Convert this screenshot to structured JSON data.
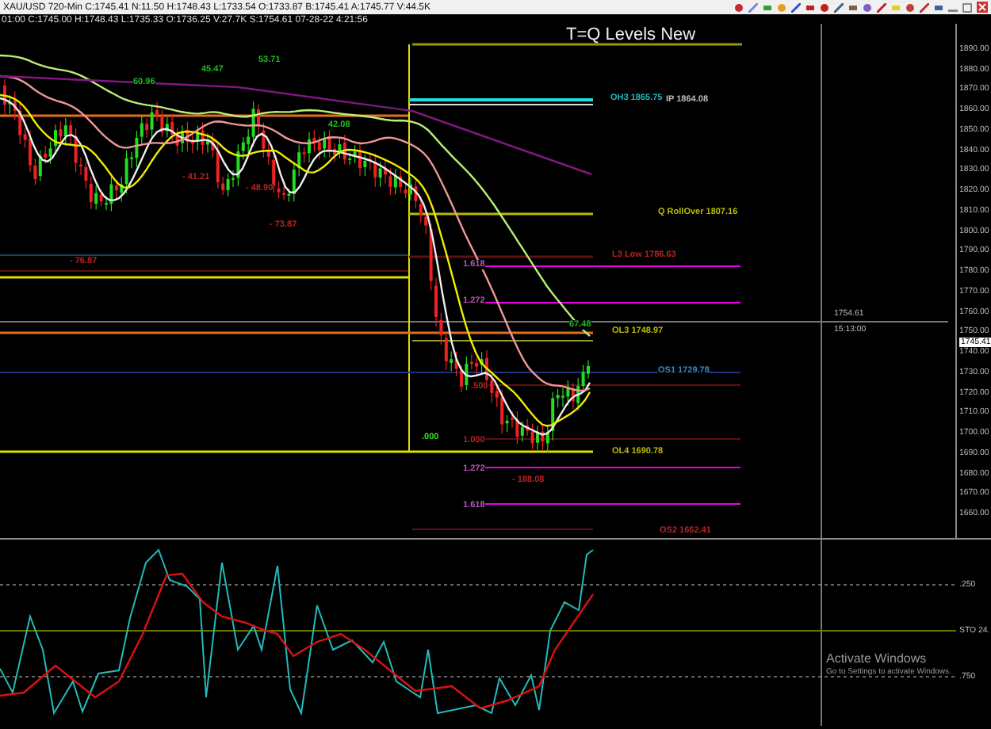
{
  "header": {
    "quote_line": "XAU/USD 720-Min C:1745.41 N:11.50 H:1748.43 L:1733.54 O:1733.87 B:1745.41 A:1745.77 V:44.5K"
  },
  "info_line": "01:00 C:1745.00 H:1748.43 L:1735.33 O:1736.25 V:27.7K S:1754.61 07-28-22 4:21:56",
  "chart": {
    "title": "T=Q Levels New",
    "price_axis": [
      "1890.00",
      "1880.00",
      "1870.00",
      "1860.00",
      "1850.00",
      "1840.00",
      "1830.00",
      "1820.00",
      "1810.00",
      "1800.00",
      "1790.00",
      "1780.00",
      "1770.00",
      "1760.00",
      "1750.00",
      "1740.00",
      "1730.00",
      "1720.00",
      "1710.00",
      "1700.00",
      "1690.00",
      "1680.00",
      "1670.00",
      "1660.00"
    ],
    "current_price": "1745.41",
    "crosshair": {
      "price": "1754.61",
      "time": "15:13:00"
    },
    "annotations": [
      {
        "text": "45.47",
        "color": "#22bb22"
      },
      {
        "text": "53.71",
        "color": "#22bb22"
      },
      {
        "text": "60.96",
        "color": "#22bb22"
      },
      {
        "text": "42.08",
        "color": "#22bb22"
      },
      {
        "text": "- 41.21",
        "color": "#bb2222"
      },
      {
        "text": "- 48.90",
        "color": "#bb2222"
      },
      {
        "text": "- 73.87",
        "color": "#bb2222"
      },
      {
        "text": "- 76.87",
        "color": "#bb2222"
      },
      {
        "text": "OH3 1865.75",
        "color": "#22bbbb"
      },
      {
        "text": "IP 1864.08",
        "color": "#bbbbbb"
      },
      {
        "text": "Q RollOver 1807.16",
        "color": "#bbbb00"
      },
      {
        "text": "L3 Low 1786.63",
        "color": "#bb2222"
      },
      {
        "text": "1.618",
        "color": "#bb55bb"
      },
      {
        "text": "1.272",
        "color": "#bb55bb"
      },
      {
        "text": "67.48",
        "color": "#22bb22"
      },
      {
        "text": "OL3 1748.97",
        "color": "#bbbb00"
      },
      {
        "text": "OS1 1729.78",
        "color": "#3388cc"
      },
      {
        "text": ".500",
        "color": "#bb2222"
      },
      {
        "text": ".000",
        "color": "#33dd33"
      },
      {
        "text": "1.000",
        "color": "#bb2222"
      },
      {
        "text": "OL4 1690.78",
        "color": "#bbbb00"
      },
      {
        "text": "1.272",
        "color": "#bb55bb"
      },
      {
        "text": "- 188.08",
        "color": "#bb2222"
      },
      {
        "text": "1.618",
        "color": "#bb55bb"
      },
      {
        "text": "OS2 1662.41",
        "color": "#bb2222"
      }
    ]
  },
  "oscillator": {
    "labels": [
      ".250",
      "STO 24.",
      ".750"
    ]
  },
  "os_notice": {
    "title": "Activate Windows",
    "text": "Go to Settings to activate Windows."
  }
}
